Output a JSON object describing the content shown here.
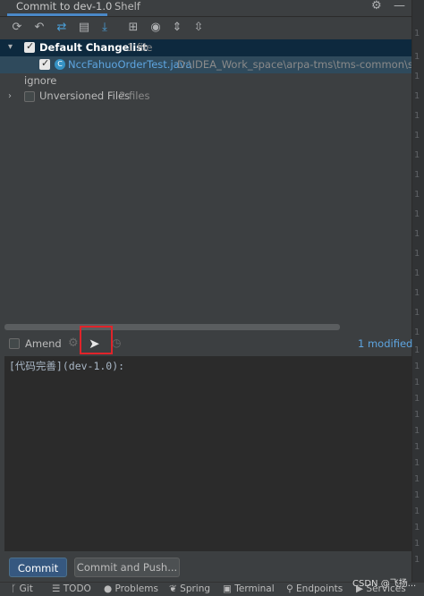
{
  "tabs": {
    "commit": "Commit to dev-1.0",
    "shelf": "Shelf"
  },
  "icons": {
    "gear": "gear-icon",
    "minimize": "minimize-icon",
    "toolbar": [
      "refresh-icon",
      "rollback-icon",
      "diff-icon",
      "shelve-icon",
      "download-icon",
      "group-by-icon",
      "view-options-icon",
      "expand-all-icon",
      "collapse-all-icon"
    ]
  },
  "changes": {
    "default_changelist": {
      "name": "Default Changelist",
      "count": "1 file"
    },
    "file": {
      "name": "NccFahuoOrderTest.java",
      "path": "D:\\IDEA_Work_space\\arpa-tms\\tms-common\\src\\test\\"
    },
    "ignore": "ignore",
    "unversioned": {
      "name": "Unversioned Files",
      "count": "2 files"
    }
  },
  "options": {
    "amend": "Amend",
    "modified": "1 modified"
  },
  "message": "[代码完善](dev-1.0):",
  "buttons": {
    "commit": "Commit",
    "commit_and_push": "Commit and Push..."
  },
  "statusbar": [
    "Git",
    "TODO",
    "Problems",
    "Spring",
    "Terminal",
    "Endpoints",
    "Services"
  ],
  "gutter": [
    "1",
    "1",
    "1",
    "1",
    "1",
    "1",
    "1",
    "1",
    "1",
    "1",
    "1",
    "1",
    "1",
    "1",
    "1",
    "1",
    "1",
    "1",
    "1",
    "1",
    "1",
    "1",
    "1",
    "1",
    "1",
    "1",
    "1",
    "1",
    "1",
    "1",
    "1",
    "1",
    "1",
    "1"
  ],
  "watermark": "CSDN @飞扬..."
}
